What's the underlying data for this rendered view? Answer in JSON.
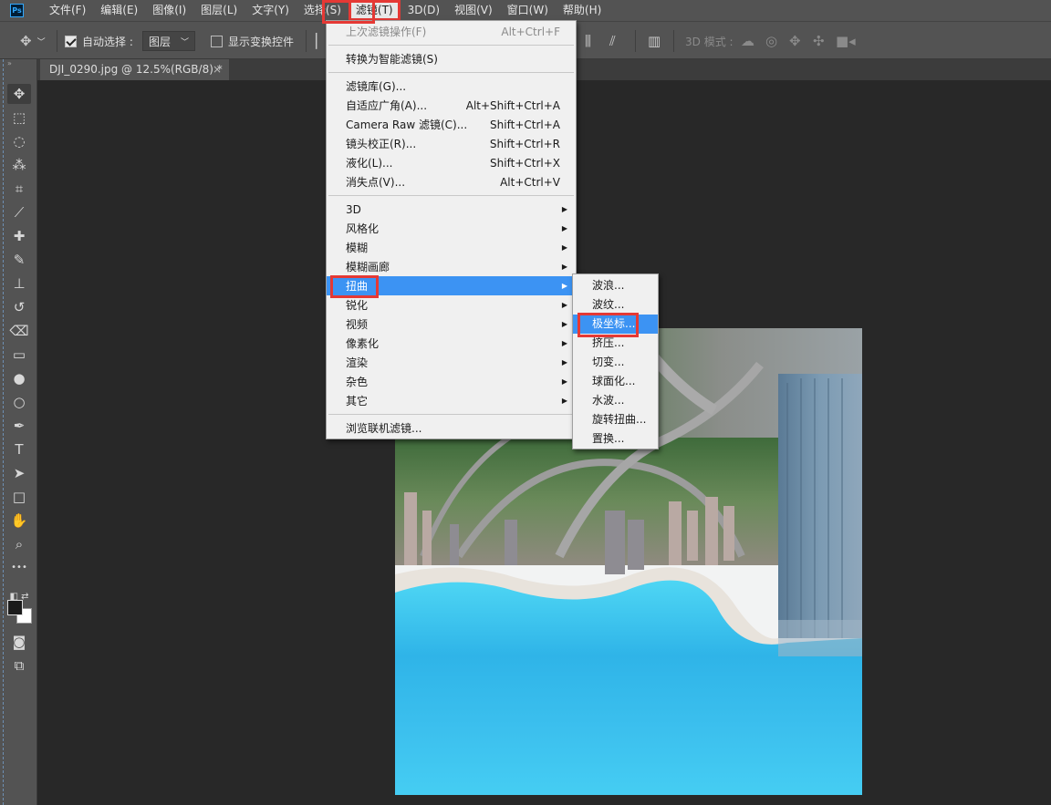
{
  "app": {
    "logo": "Ps"
  },
  "menubar": {
    "items": [
      "文件(F)",
      "编辑(E)",
      "图像(I)",
      "图层(L)",
      "文字(Y)",
      "选择(S)",
      "滤镜(T)",
      "3D(D)",
      "视图(V)",
      "窗口(W)",
      "帮助(H)"
    ],
    "active_index": 6
  },
  "options": {
    "auto_select_label": "自动选择 :",
    "auto_select_checked": true,
    "layer_select_value": "图层",
    "show_transform_label": "显示变换控件",
    "show_transform_checked": false,
    "mode_3d_label": "3D 模式 :"
  },
  "document": {
    "tab_title": "DJI_0290.jpg @ 12.5%(RGB/8) *",
    "close_glyph": "×"
  },
  "tools": [
    {
      "name": "move-tool-icon",
      "glyph": "✥"
    },
    {
      "name": "marquee-tool-icon",
      "glyph": "⬚"
    },
    {
      "name": "lasso-tool-icon",
      "glyph": "◌"
    },
    {
      "name": "magic-wand-tool-icon",
      "glyph": "⁂"
    },
    {
      "name": "crop-tool-icon",
      "glyph": "⌗"
    },
    {
      "name": "eyedropper-tool-icon",
      "glyph": "⟋"
    },
    {
      "name": "healing-brush-tool-icon",
      "glyph": "✚"
    },
    {
      "name": "brush-tool-icon",
      "glyph": "✎"
    },
    {
      "name": "clone-stamp-tool-icon",
      "glyph": "⊥"
    },
    {
      "name": "history-brush-tool-icon",
      "glyph": "↺"
    },
    {
      "name": "eraser-tool-icon",
      "glyph": "⌫"
    },
    {
      "name": "gradient-tool-icon",
      "glyph": "▭"
    },
    {
      "name": "blur-tool-icon",
      "glyph": "●"
    },
    {
      "name": "dodge-tool-icon",
      "glyph": "○"
    },
    {
      "name": "pen-tool-icon",
      "glyph": "✒"
    },
    {
      "name": "type-tool-icon",
      "glyph": "T"
    },
    {
      "name": "path-selection-tool-icon",
      "glyph": "➤"
    },
    {
      "name": "rectangle-tool-icon",
      "glyph": "□"
    },
    {
      "name": "hand-tool-icon",
      "glyph": "✋"
    },
    {
      "name": "zoom-tool-icon",
      "glyph": "⌕"
    },
    {
      "name": "more-tools-icon",
      "glyph": "•••"
    }
  ],
  "filter_menu": {
    "groups": [
      [
        {
          "label": "上次滤镜操作(F)",
          "shortcut": "Alt+Ctrl+F",
          "disabled": true
        }
      ],
      [
        {
          "label": "转换为智能滤镜(S)",
          "shortcut": ""
        }
      ],
      [
        {
          "label": "滤镜库(G)...",
          "shortcut": ""
        },
        {
          "label": "自适应广角(A)...",
          "shortcut": "Alt+Shift+Ctrl+A"
        },
        {
          "label": "Camera Raw 滤镜(C)...",
          "shortcut": "Shift+Ctrl+A"
        },
        {
          "label": "镜头校正(R)...",
          "shortcut": "Shift+Ctrl+R"
        },
        {
          "label": "液化(L)...",
          "shortcut": "Shift+Ctrl+X"
        },
        {
          "label": "消失点(V)...",
          "shortcut": "Alt+Ctrl+V"
        }
      ],
      [
        {
          "label": "3D",
          "submenu": true
        },
        {
          "label": "风格化",
          "submenu": true
        },
        {
          "label": "模糊",
          "submenu": true
        },
        {
          "label": "模糊画廊",
          "submenu": true
        },
        {
          "label": "扭曲",
          "submenu": true,
          "highlighted": true
        },
        {
          "label": "锐化",
          "submenu": true
        },
        {
          "label": "视频",
          "submenu": true
        },
        {
          "label": "像素化",
          "submenu": true
        },
        {
          "label": "渲染",
          "submenu": true
        },
        {
          "label": "杂色",
          "submenu": true
        },
        {
          "label": "其它",
          "submenu": true
        }
      ],
      [
        {
          "label": "浏览联机滤镜..."
        }
      ]
    ]
  },
  "distort_submenu": {
    "items": [
      "波浪...",
      "波纹...",
      "极坐标...",
      "挤压...",
      "切变...",
      "球面化...",
      "水波...",
      "旋转扭曲...",
      "置换..."
    ],
    "highlighted_index": 2
  },
  "colors": {
    "highlight": "#3c93f3",
    "callout": "#e53935",
    "menu_bg": "#f0f0f0",
    "ui_bg": "#535353",
    "workspace": "#282828"
  }
}
